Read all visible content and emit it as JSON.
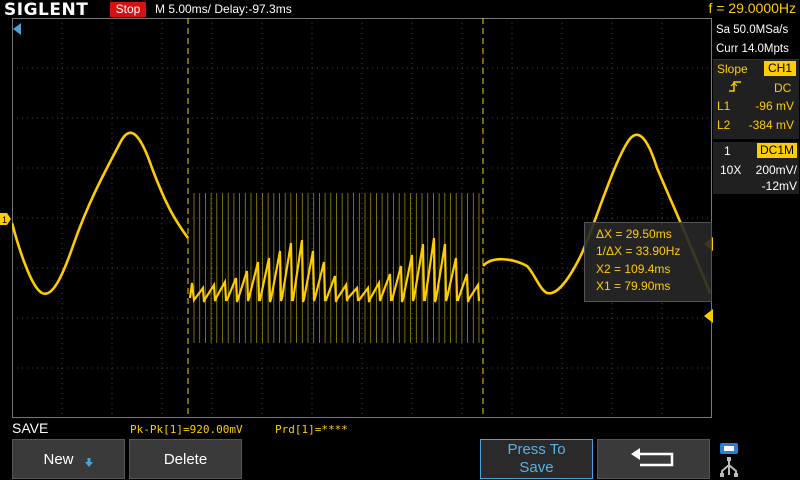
{
  "header": {
    "brand": "SIGLENT",
    "run_state": "Stop",
    "timebase": "M 5.00ms/ Delay:-97.3ms",
    "frequency": "f = 29.0000Hz"
  },
  "acquisition": {
    "sample_rate": "Sa 50.0MSa/s",
    "memory": "Curr 14.0Mpts"
  },
  "trigger": {
    "title": "Slope",
    "source": "CH1",
    "coupling": "DC",
    "l1_label": "L1",
    "l1_value": "-96 mV",
    "l2_label": "L2",
    "l2_value": "-384 mV"
  },
  "channel": {
    "number": "1",
    "coupling": "DC1M",
    "probe": "10X",
    "volts_per_div": "200mV/",
    "offset": "-12mV"
  },
  "cursor": {
    "dx": "ΔX = 29.50ms",
    "inv_dx": "1/ΔX = 33.90Hz",
    "x2": "X2 = 109.4ms",
    "x1": "X1 = 79.90ms"
  },
  "measurements": {
    "pkpk": "Pk-Pk[1]=920.00mV",
    "prd": "Prd[1]=****"
  },
  "menu": {
    "title": "SAVE",
    "new_label": "New",
    "delete_label": "Delete",
    "press_line1": "Press To",
    "press_line2": "Save"
  },
  "colors": {
    "trace": "#ffcc00",
    "stop": "#d81010",
    "accent_blue": "#4aa3d6"
  }
}
